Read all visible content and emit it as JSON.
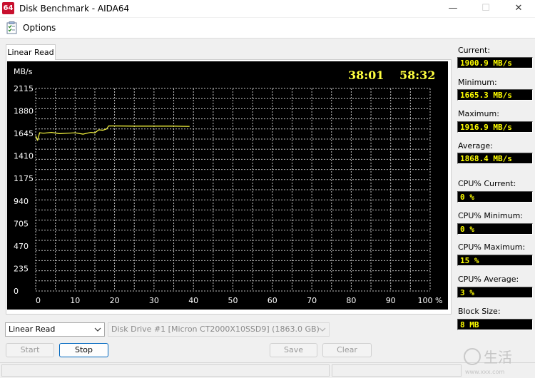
{
  "window": {
    "app_icon_text": "64",
    "title": "Disk Benchmark - AIDA64",
    "controls": {
      "minimize": "—",
      "maximize": "☐",
      "close": "✕"
    }
  },
  "menu": {
    "options_label": "Options",
    "options_icon": "checklist-icon"
  },
  "tab": {
    "label": "Linear Read"
  },
  "chart": {
    "timer_elapsed": "38:01",
    "timer_total": "58:32"
  },
  "chart_data": {
    "type": "line",
    "ylabel": "MB/s",
    "y_ticks": [
      "2115",
      "1880",
      "1645",
      "1410",
      "1175",
      "940",
      "705",
      "470",
      "235",
      "0"
    ],
    "x_ticks": [
      "0",
      "10",
      "20",
      "30",
      "40",
      "50",
      "60",
      "70",
      "80",
      "90",
      "100 %"
    ],
    "xlim": [
      0,
      100
    ],
    "ylim": [
      0,
      2350
    ],
    "grid": true,
    "series": [
      {
        "color": "#ffff40",
        "x": [
          0,
          0.5,
          1,
          2,
          4,
          6,
          8,
          10,
          12,
          13,
          14,
          15,
          16,
          17,
          18,
          18.5,
          20,
          25,
          30,
          35,
          39
        ],
        "y": [
          1800,
          1750,
          1835,
          1830,
          1840,
          1825,
          1830,
          1835,
          1820,
          1830,
          1840,
          1835,
          1870,
          1865,
          1880,
          1915,
          1915,
          1912,
          1912,
          1912,
          1910
        ]
      }
    ]
  },
  "stats": {
    "current": {
      "label": "Current:",
      "value": "1900.9 MB/s"
    },
    "minimum": {
      "label": "Minimum:",
      "value": "1665.3 MB/s"
    },
    "maximum": {
      "label": "Maximum:",
      "value": "1916.9 MB/s"
    },
    "average": {
      "label": "Average:",
      "value": "1868.4 MB/s"
    },
    "cpu_current": {
      "label": "CPU% Current:",
      "value": "0 %"
    },
    "cpu_minimum": {
      "label": "CPU% Minimum:",
      "value": "0 %"
    },
    "cpu_maximum": {
      "label": "CPU% Maximum:",
      "value": "15 %"
    },
    "cpu_average": {
      "label": "CPU% Average:",
      "value": "3 %"
    },
    "block_size": {
      "label": "Block Size:",
      "value": "8 MB"
    }
  },
  "controls": {
    "test_select": "Linear Read",
    "drive_select": "Disk Drive #1  [Micron  CT2000X10SSD9]  (1863.0 GB)",
    "start_label": "Start",
    "stop_label": "Stop",
    "save_label": "Save",
    "clear_label": "Clear"
  },
  "watermark": {
    "text": "生活",
    "url_text": "www.xxx.com"
  }
}
